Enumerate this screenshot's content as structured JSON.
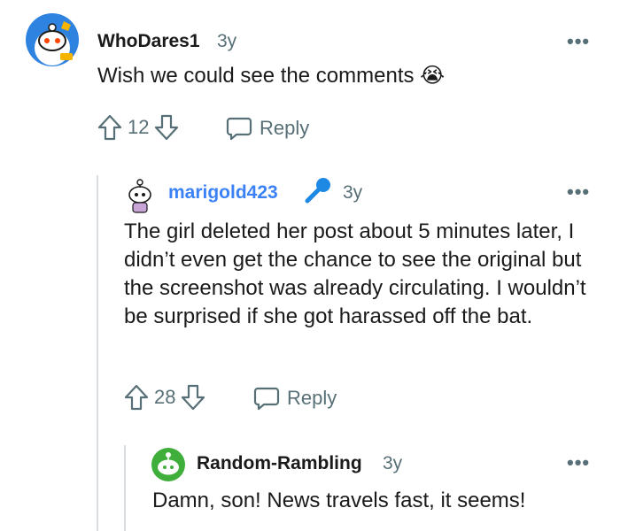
{
  "comments": [
    {
      "username": "WhoDares1",
      "age": "3y",
      "body": "Wish we could see the comments 😭",
      "score": "12",
      "reply_label": "Reply",
      "more_label": "•••"
    },
    {
      "username": "marigold423",
      "age": "3y",
      "body": "The girl deleted her post about 5 minutes later, I didn’t even get the chance to see the original but the screenshot was already circulating. I wouldn’t be surprised if she got harassed off the bat.",
      "score": "28",
      "reply_label": "Reply",
      "more_label": "•••"
    },
    {
      "username": "Random-Rambling",
      "age": "3y",
      "body": "Damn, son! News travels fast, it seems!",
      "more_label": "•••"
    }
  ],
  "colors": {
    "text": "#1a1a1b",
    "muted": "#576f76",
    "link": "#3b82f6",
    "thread_line": "#d9dde0"
  },
  "icons": [
    "avatar",
    "upvote-icon",
    "downvote-icon",
    "comment-icon",
    "microphone-icon",
    "crying-emoji"
  ]
}
